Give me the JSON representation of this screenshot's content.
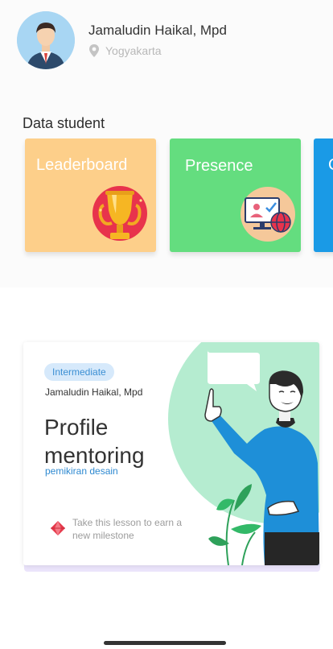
{
  "profile": {
    "name": "Jamaludin Haikal, Mpd",
    "location": "Yogyakarta",
    "avatar_icon": "user-avatar"
  },
  "data_student": {
    "title": "Data student",
    "cards": [
      {
        "label": "Leaderboard",
        "color": "#fdcf8a",
        "icon": "trophy-icon"
      },
      {
        "label": "Presence",
        "color": "#64dd7f",
        "icon": "presence-monitor-icon"
      },
      {
        "label": "C",
        "color": "#1a9ae6"
      }
    ]
  },
  "lesson": {
    "level": "Intermediate",
    "mentor": "Jamaludin Haikal, Mpd",
    "title": "Profile mentoring",
    "subtitle": "pemikiran desain",
    "milestone": "Take this lesson to earn a new milestone",
    "accent_color": "#b5ecd0",
    "illustration": "mentor-pointing-illustration"
  }
}
